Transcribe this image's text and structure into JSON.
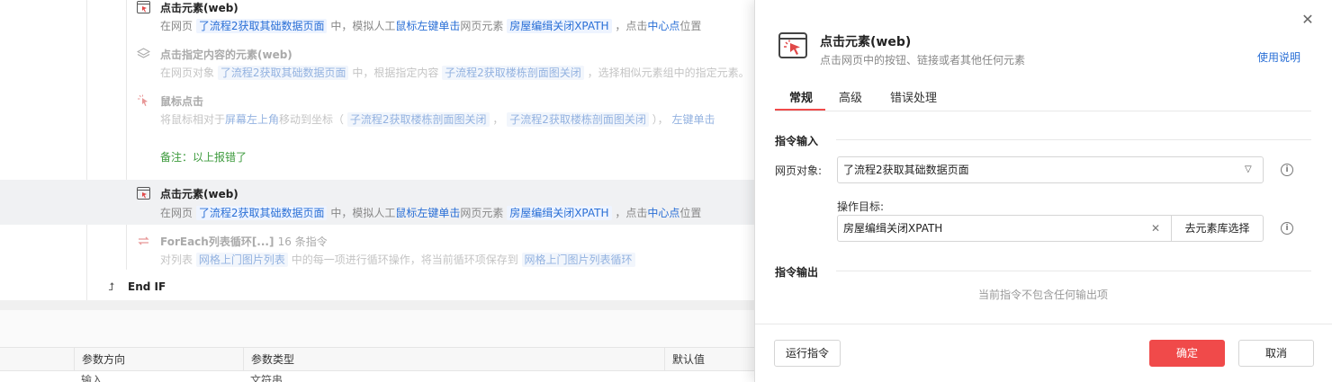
{
  "flow": {
    "steps": [
      {
        "title": "点击元素(web)",
        "desc": {
          "p1": "在网页",
          "obj": "了流程2获取其础数据页面",
          "p2": "中，模拟人工",
          "action": "鼠标左键单击",
          "p3": "网页元素",
          "elem": "房屋编缉关闭XPATH",
          "p4": "，点击",
          "pos": "中心点",
          "p5": "位置"
        }
      },
      {
        "title": "点击指定内容的元素(web)",
        "desc": {
          "p1": "在网页对象",
          "obj": "了流程2获取其础数据页面",
          "p2": "中，根据指定内容",
          "content": "子流程2获取楼栋剖面图关闭",
          "p3": "，选择相似元素组中的指定元素。"
        }
      },
      {
        "title": "鼠标点击",
        "desc": {
          "p1": "将鼠标相对于",
          "rel": "屏幕左上角",
          "p2": "移动到坐标（",
          "x": "子流程2获取楼栋剖面图关闭",
          "comma": "，",
          "y": "子流程2获取楼栋剖面图关闭",
          "p3": "），",
          "click": "左键单击"
        }
      },
      {
        "title": "点击元素(web)",
        "desc": {
          "p1": "在网页",
          "obj": "了流程2获取其础数据页面",
          "p2": "中，模拟人工",
          "action": "鼠标左键单击",
          "p3": "网页元素",
          "elem": "房屋编缉关闭XPATH",
          "p4": "，点击",
          "pos": "中心点",
          "p5": "位置"
        }
      },
      {
        "title": "ForEach列表循环[...]",
        "count": "16 条指令",
        "desc": {
          "p1": "对列表",
          "list": "网格上门图片列表",
          "p2": "中的每一项进行循环操作，将当前循环项保存到",
          "item": "网格上门图片列表循环"
        }
      }
    ],
    "note": "备注：以上报错了",
    "end_if": "End IF"
  },
  "params_table": {
    "headers": [
      "参数方向",
      "参数类型",
      "默认值"
    ],
    "row": [
      "输入",
      "文符串"
    ]
  },
  "dialog": {
    "title": "点击元素(web)",
    "subtitle": "点击网页中的按钮、链接或者其他任何元素",
    "help": "使用说明",
    "tabs": [
      "常规",
      "高级",
      "错误处理"
    ],
    "section_input": "指令输入",
    "page_object_label": "网页对象:",
    "page_object_value": "了流程2获取其础数据页面",
    "target_label": "操作目标:",
    "target_value": "房屋编缉关闭XPATH",
    "pick_button": "去元素库选择",
    "section_output": "指令输出",
    "no_output": "当前指令不包含任何输出项",
    "run_button": "运行指令",
    "ok_button": "确定",
    "cancel_button": "取消"
  },
  "colors": {
    "accent": "#f04a4a",
    "link": "#2a6fd6",
    "note": "#3c9a3c"
  }
}
